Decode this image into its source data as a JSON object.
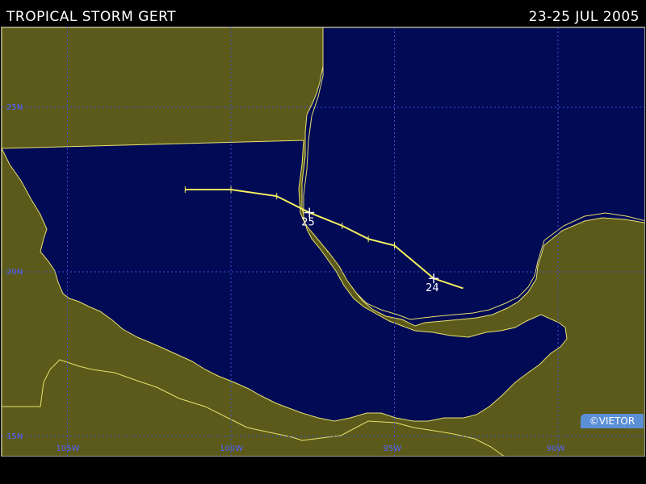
{
  "header": {
    "title": "TROPICAL STORM GERT",
    "dates": "23-25 JUL 2005"
  },
  "map": {
    "colors": {
      "ocean": "#000a55",
      "land": "#5b5a1a",
      "coast": "#e8e070",
      "grid": "#4150d8",
      "track": "#f8f060",
      "markers": "#ffffff"
    },
    "latitude_labels": [
      {
        "lat": 25,
        "label": "25N"
      },
      {
        "lat": 20,
        "label": "20N"
      },
      {
        "lat": 15,
        "label": "15N"
      }
    ],
    "longitude_labels": [
      {
        "lon": -105,
        "label": "105W"
      },
      {
        "lon": -100,
        "label": "100W"
      },
      {
        "lon": -95,
        "label": "95W"
      },
      {
        "lon": -90,
        "label": "90W"
      }
    ],
    "track": [
      {
        "lat": 19.5,
        "lon": -92.9
      },
      {
        "lat": 19.8,
        "lon": -93.8,
        "day": "24"
      },
      {
        "lat": 20.8,
        "lon": -95.0
      },
      {
        "lat": 21.0,
        "lon": -95.8
      },
      {
        "lat": 21.4,
        "lon": -96.6
      },
      {
        "lat": 21.8,
        "lon": -97.6,
        "day": "25"
      },
      {
        "lat": 22.3,
        "lon": -98.6
      },
      {
        "lat": 22.5,
        "lon": -100.0
      },
      {
        "lat": 22.5,
        "lon": -101.4
      }
    ]
  },
  "credit": "©VIETOR"
}
